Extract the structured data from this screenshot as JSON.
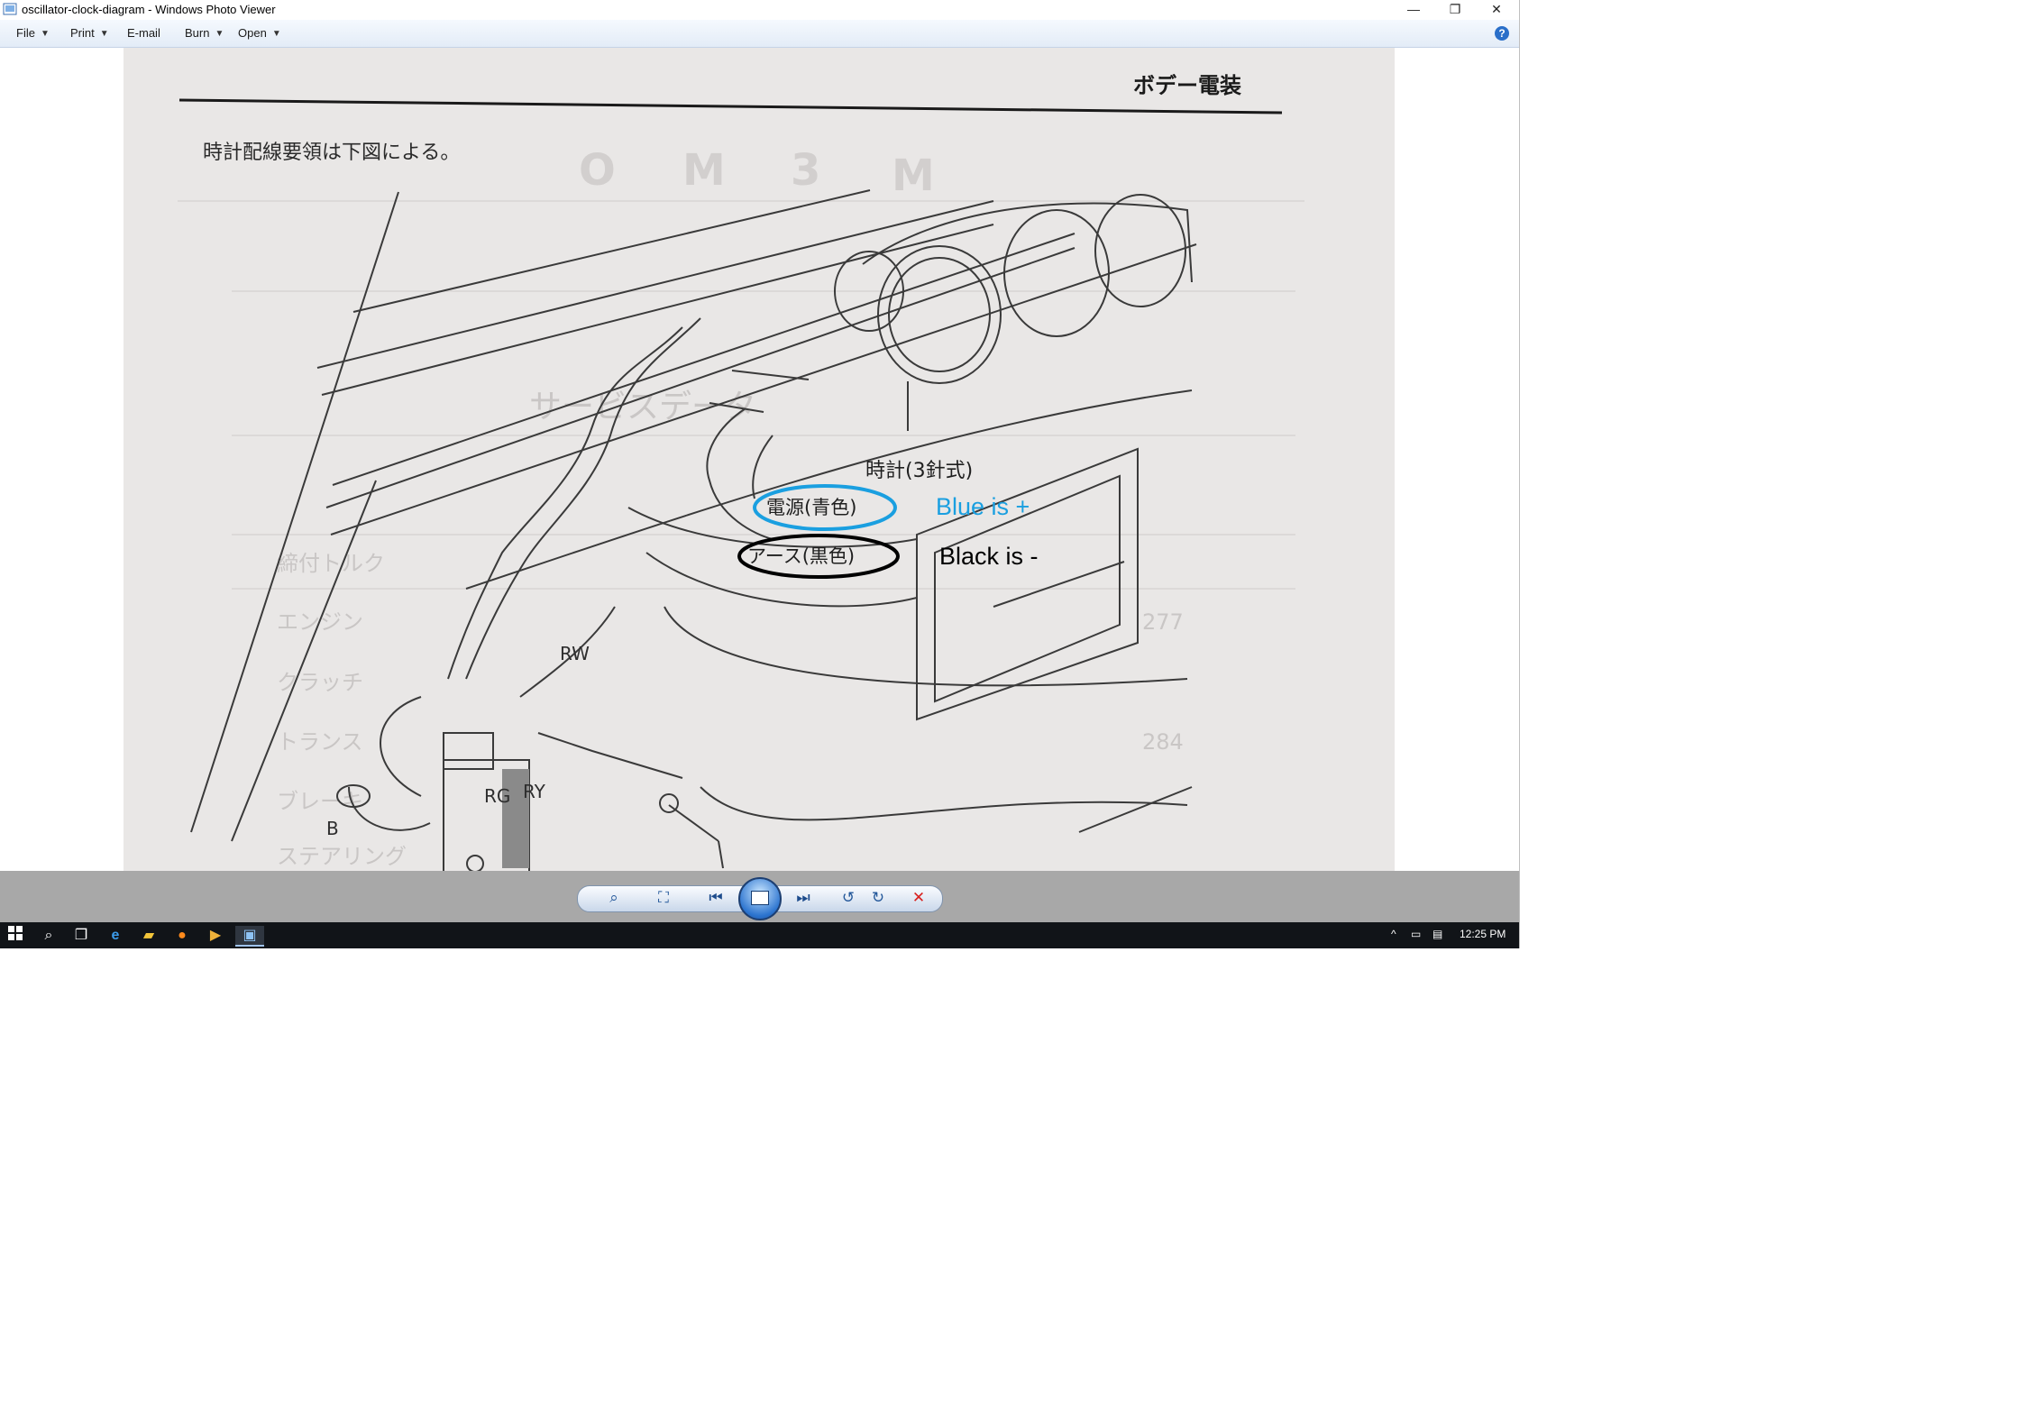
{
  "window": {
    "title": "oscillator-clock-diagram - Windows Photo Viewer",
    "minimize_label": "—",
    "restore_label": "❐",
    "close_label": "✕"
  },
  "menu": {
    "items": [
      {
        "label": "File"
      },
      {
        "label": "Print"
      },
      {
        "label": "E-mail"
      },
      {
        "label": "Burn"
      },
      {
        "label": "Open"
      }
    ],
    "help_label": "?"
  },
  "document": {
    "header": "ボデー電装",
    "intro": "時計配線要領は下図による。",
    "watermark_letters": [
      "O",
      "M",
      "3",
      "M"
    ],
    "clock_label": "時計(3針式)",
    "power_label": "電源(青色)",
    "ground_label": "アース(黒色)",
    "wire_labels": [
      "RW",
      "RG",
      "RY",
      "B"
    ],
    "bleed_text": [
      "エンジン",
      "クラッチ",
      "トランス",
      "ブレーキ",
      "ステアリング",
      "締付トルク",
      "サービスデータ"
    ],
    "bleed_numbers": [
      "277",
      "284"
    ]
  },
  "annotations": {
    "blue_text": "Blue is +",
    "black_text": "Black is -",
    "blue_color": "#1a9fe0",
    "black_color": "#000000"
  },
  "toolbar": {
    "zoom_icon": "magnifier-icon",
    "actual_size_icon": "fit-window-icon",
    "previous_icon": "previous-icon",
    "slideshow_icon": "slideshow-icon",
    "next_icon": "next-icon",
    "rotate_ccw_icon": "rotate-counterclockwise-icon",
    "rotate_cw_icon": "rotate-clockwise-icon",
    "delete_icon": "delete-icon"
  },
  "taskbar": {
    "clock": "12:25 PM"
  }
}
